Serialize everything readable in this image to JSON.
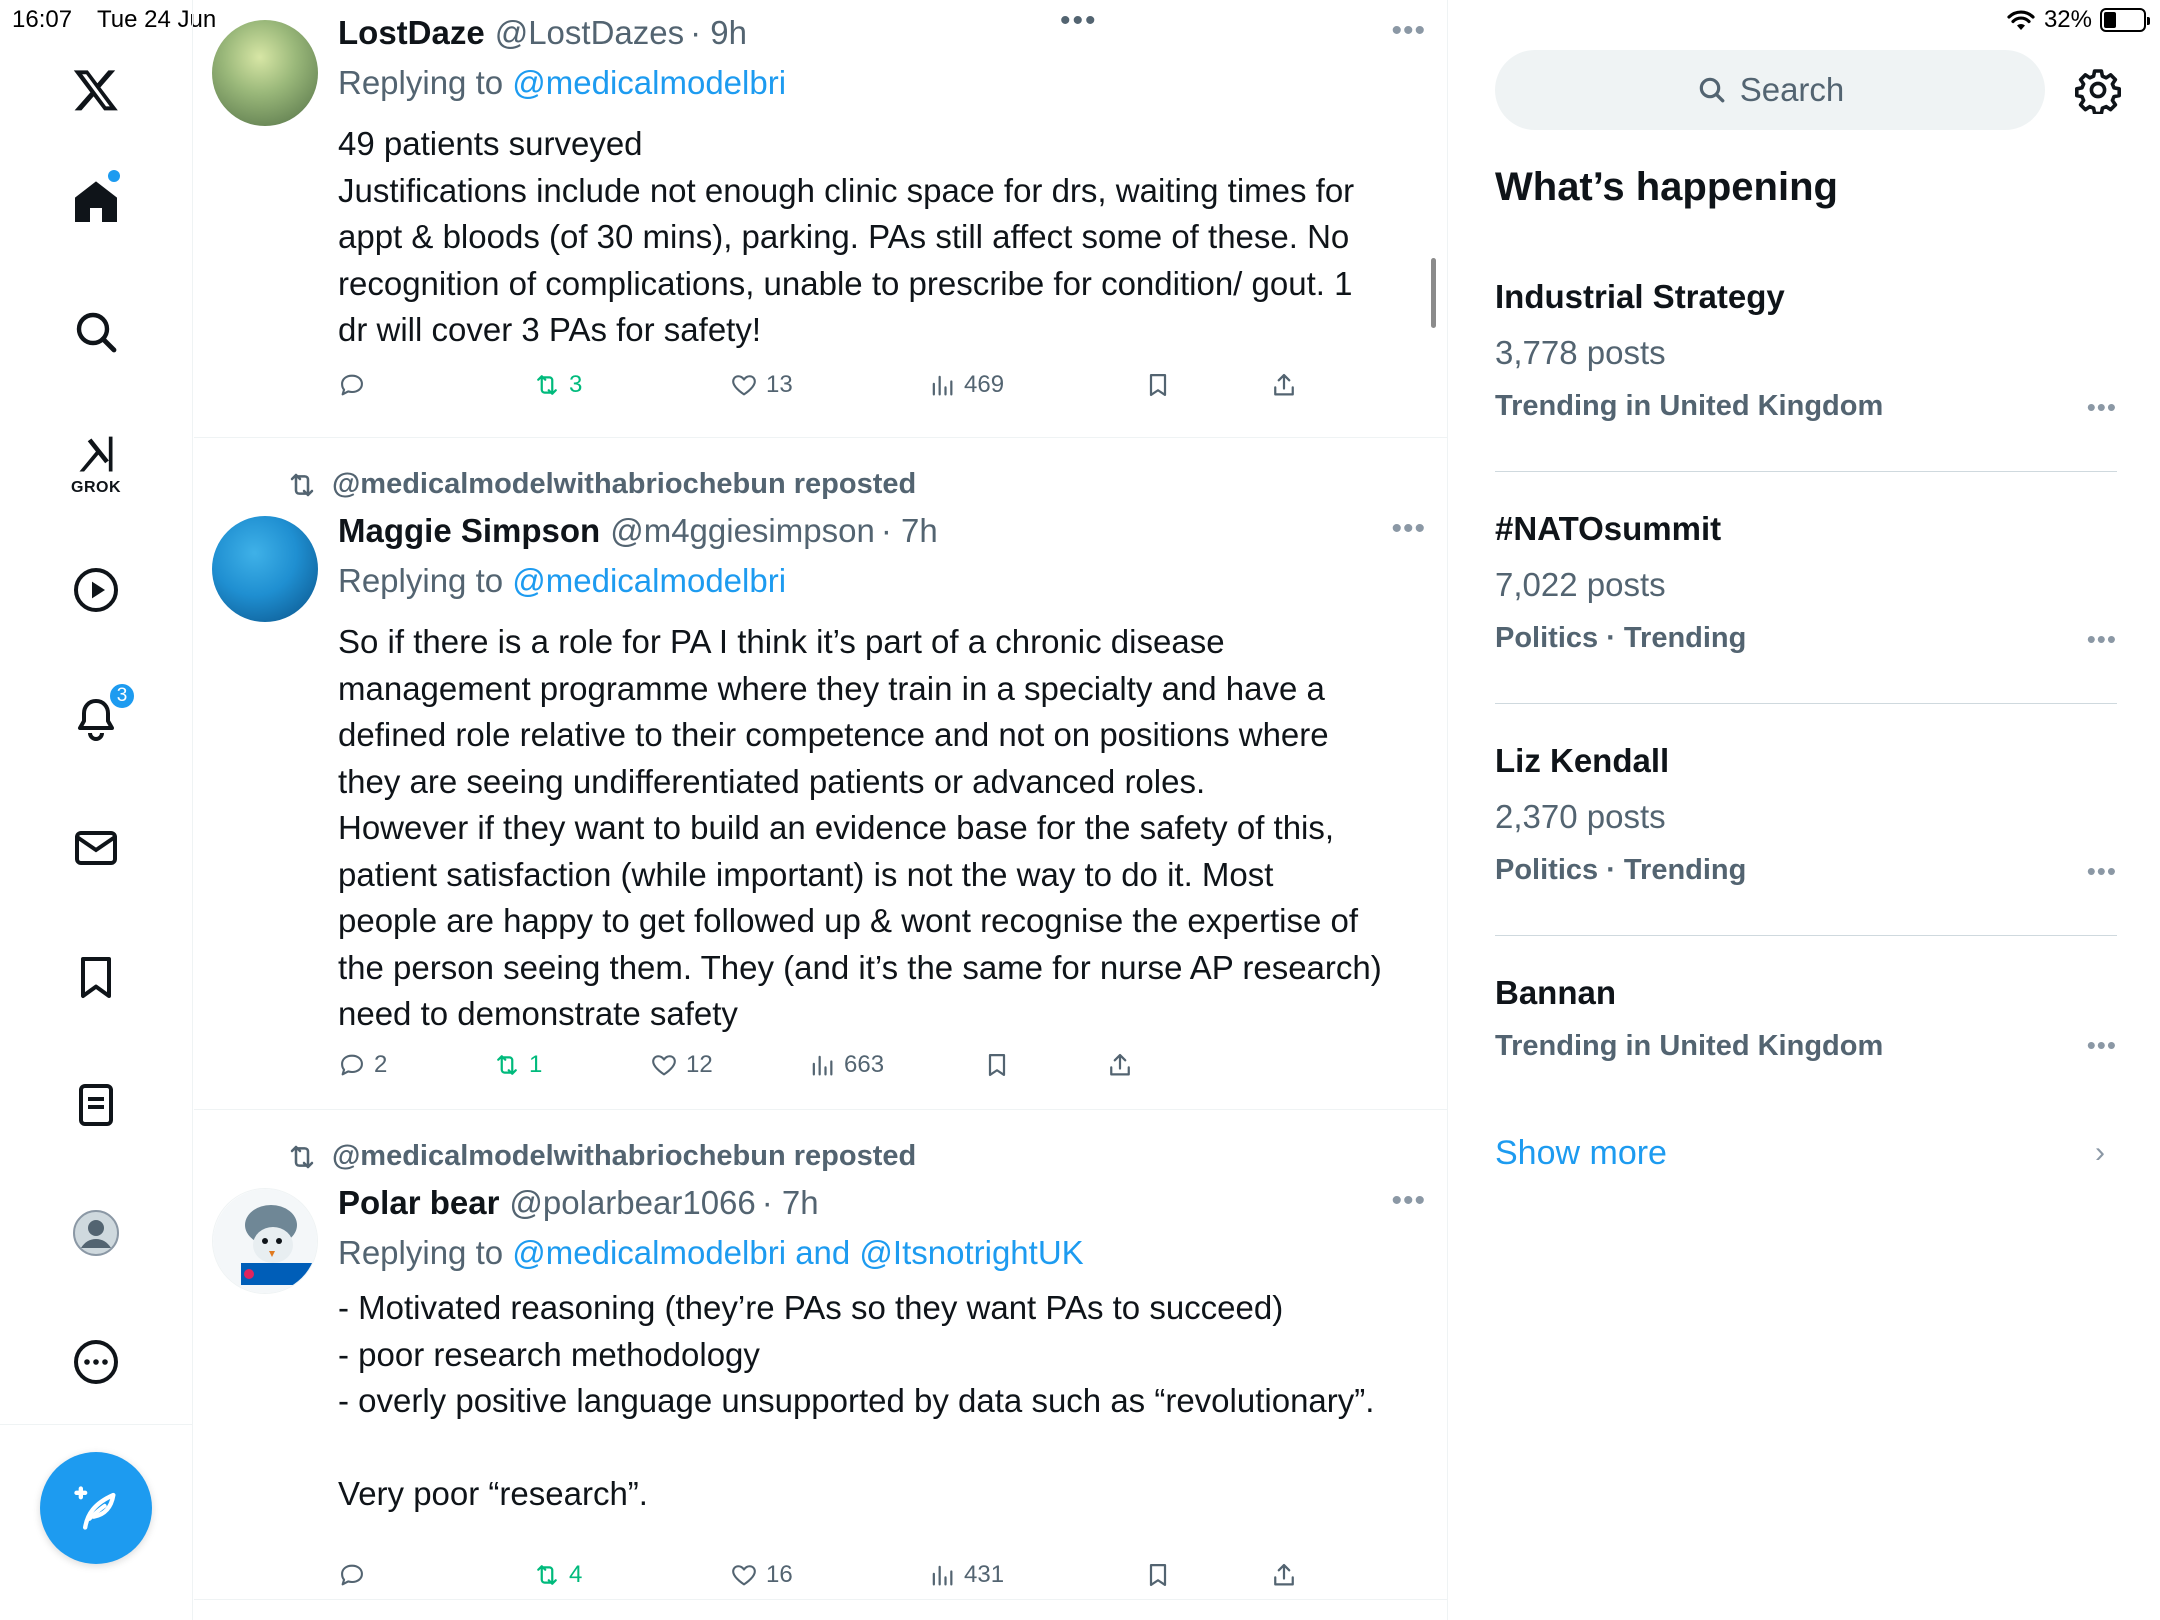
{
  "status": {
    "time": "16:07",
    "date": "Tue 24 Jun",
    "battery": "32%",
    "battery_level": 0.32
  },
  "nav": {
    "items": [
      "x-logo",
      "home",
      "explore",
      "grok",
      "video",
      "notifications",
      "messages",
      "bookmarks",
      "lists",
      "profile",
      "more"
    ],
    "grok_label": "GROK",
    "notifications_badge": "3"
  },
  "feed": {
    "tweets": [
      {
        "name": "LostDaze",
        "handle": "@LostDazes",
        "time": "· 9h",
        "reply_prefix": "Replying to ",
        "reply_to": "@medicalmodelbri",
        "lines": [
          "49 patients surveyed",
          "Justifications include not enough clinic space for drs, waiting times for",
          "appt & bloods (of 30 mins), parking. PAs still affect some of these. No",
          "recognition of complications, unable to prescribe for condition/ gout. 1",
          "dr will cover 3 PAs for safety!"
        ],
        "replies": "",
        "reposts": "3",
        "likes": "13",
        "views": "469"
      },
      {
        "repost_label": "@medicalmodelwithabriochebun reposted",
        "name": "Maggie Simpson",
        "handle": "@m4ggiesimpson",
        "time": "· 7h",
        "reply_prefix": "Replying to ",
        "reply_to": "@medicalmodelbri",
        "lines": [
          "So if there is a role for PA I think it’s part of a chronic disease",
          "management programme where they train in a specialty and have a",
          "defined role relative to their competence and not on positions where",
          "they are seeing undifferentiated patients or advanced roles.",
          "However if they want to build an evidence base for the safety of this,",
          "patient satisfaction (while important) is not the way to do it. Most",
          "people are happy to get followed up & wont recognise the expertise of",
          "the person seeing them. They (and it’s the same for nurse AP research)",
          "need to demonstrate safety"
        ],
        "replies": "2",
        "reposts": "1",
        "likes": "12",
        "views": "663"
      },
      {
        "repost_label": "@medicalmodelwithabriochebun reposted",
        "name": "Polar bear",
        "handle": "@polarbear1066",
        "time": "· 7h",
        "reply_prefix": "Replying to ",
        "reply_to": "@medicalmodelbri and @ItsnotrightUK",
        "lines": [
          "- Motivated reasoning (they’re PAs so they want PAs to succeed)",
          "- poor research methodology",
          "- overly positive language unsupported by data such as “revolutionary”.",
          "",
          "Very poor “research”."
        ],
        "replies": "",
        "reposts": "4",
        "likes": "16",
        "views": "431"
      }
    ]
  },
  "sidebar": {
    "search_placeholder": "Search",
    "section_title": "What’s happening",
    "trends": [
      {
        "title": "Industrial Strategy",
        "count": "3,778 posts",
        "meta": "Trending in United Kingdom"
      },
      {
        "title": "#NATOsummit",
        "count": "7,022 posts",
        "meta": "Politics · Trending"
      },
      {
        "title": "Liz Kendall",
        "count": "2,370 posts",
        "meta": "Politics · Trending"
      },
      {
        "title": "Bannan",
        "count": "",
        "meta": "Trending in United Kingdom"
      }
    ],
    "show_more": "Show more"
  },
  "colors": {
    "accent": "#1d9bf0",
    "repost_green": "#00ba7c",
    "muted": "#536471"
  }
}
